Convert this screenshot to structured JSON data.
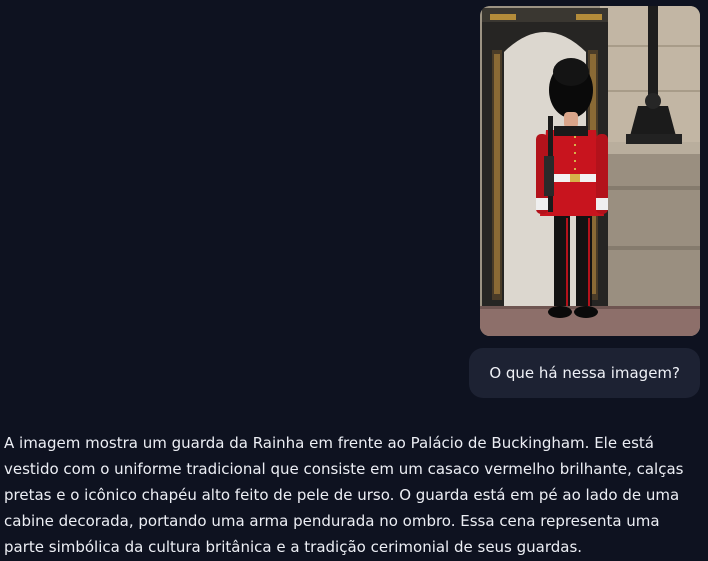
{
  "conversation": {
    "user_image": {
      "alt_icon": "photo-guard-buckingham",
      "colors": {
        "tunic": "#c8141e",
        "bearskin": "#0b0b0b",
        "trousers": "#121212",
        "sentry_box": "#2b2a29",
        "stone": "#b8ad9c"
      }
    },
    "user_message": "O que há nessa imagem?",
    "assistant_message": "A imagem mostra um guarda da Rainha em frente ao Palácio de Buckingham. Ele está vestido com o uniforme tradicional que consiste em um casaco vermelho brilhante, calças pretas e o icônico chapéu alto feito de pele de urso. O guarda está em pé ao lado de uma cabine decorada, portando uma arma pendurada no ombro. Essa cena representa uma parte simbólica da cultura britânica e a tradição cerimonial de seus guardas."
  },
  "theme": {
    "background": "#0e1220",
    "bubble": "#1d2233",
    "text": "#eceef4"
  }
}
